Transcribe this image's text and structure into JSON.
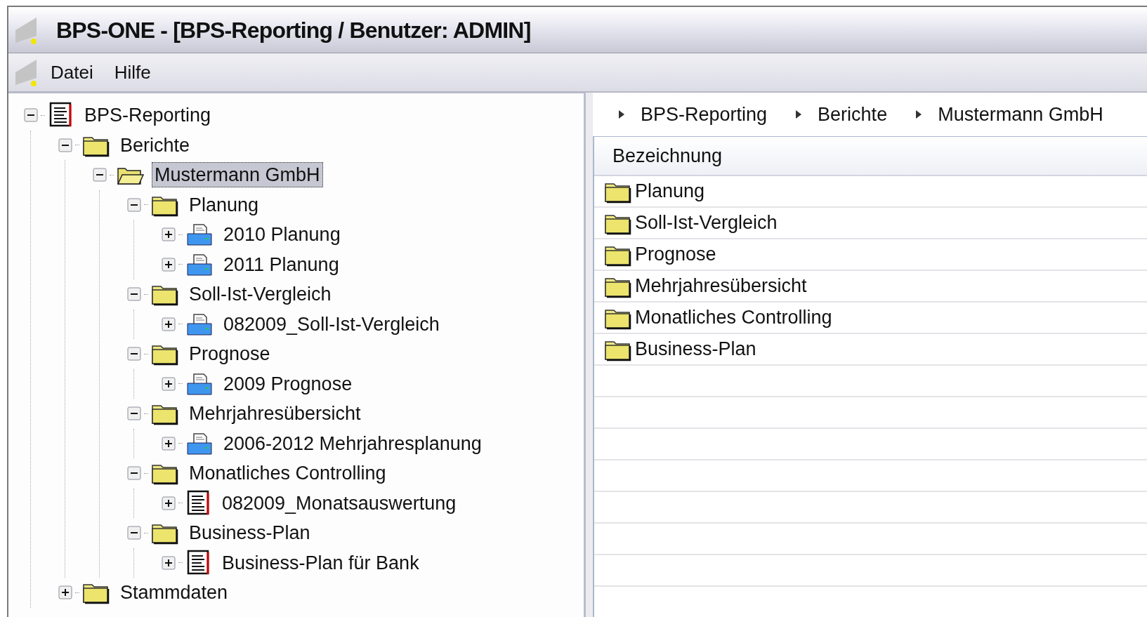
{
  "window": {
    "title": "BPS-ONE - [BPS-Reporting / Benutzer: ADMIN]"
  },
  "menu": [
    "Datei",
    "Hilfe"
  ],
  "tree": [
    {
      "label": "BPS-Reporting",
      "kind": "report",
      "expanded": true,
      "selected": false,
      "children": [
        {
          "label": "Berichte",
          "kind": "folder",
          "expanded": true,
          "selected": false,
          "children": [
            {
              "label": "Mustermann GmbH",
              "kind": "folder",
              "expanded": true,
              "selected": true,
              "children": [
                {
                  "label": "Planung",
                  "kind": "folder",
                  "expanded": true,
                  "selected": false,
                  "children": [
                    {
                      "label": "2010 Planung",
                      "kind": "print",
                      "expanded": false,
                      "selected": false
                    },
                    {
                      "label": "2011 Planung",
                      "kind": "print",
                      "expanded": false,
                      "selected": false
                    }
                  ]
                },
                {
                  "label": "Soll-Ist-Vergleich",
                  "kind": "folder",
                  "expanded": true,
                  "selected": false,
                  "children": [
                    {
                      "label": "082009_Soll-Ist-Vergleich",
                      "kind": "print",
                      "expanded": false,
                      "selected": false
                    }
                  ]
                },
                {
                  "label": "Prognose",
                  "kind": "folder",
                  "expanded": true,
                  "selected": false,
                  "children": [
                    {
                      "label": "2009 Prognose",
                      "kind": "print",
                      "expanded": false,
                      "selected": false
                    }
                  ]
                },
                {
                  "label": "Mehrjahresübersicht",
                  "kind": "folder",
                  "expanded": true,
                  "selected": false,
                  "children": [
                    {
                      "label": "2006-2012 Mehrjahresplanung",
                      "kind": "print",
                      "expanded": false,
                      "selected": false
                    }
                  ]
                },
                {
                  "label": "Monatliches Controlling",
                  "kind": "folder",
                  "expanded": true,
                  "selected": false,
                  "children": [
                    {
                      "label": "082009_Monatsauswertung",
                      "kind": "report",
                      "expanded": false,
                      "selected": false
                    }
                  ]
                },
                {
                  "label": "Business-Plan",
                  "kind": "folder",
                  "expanded": true,
                  "selected": false,
                  "children": [
                    {
                      "label": "Business-Plan für Bank",
                      "kind": "report",
                      "expanded": false,
                      "selected": false
                    }
                  ]
                }
              ]
            }
          ]
        },
        {
          "label": "Stammdaten",
          "kind": "folder",
          "expanded": false,
          "selected": false
        }
      ]
    }
  ],
  "breadcrumb": [
    "BPS-Reporting",
    "Berichte",
    "Mustermann GmbH"
  ],
  "table": {
    "columns": [
      "Bezeichnung"
    ],
    "rows": [
      {
        "label": "Planung",
        "kind": "folder"
      },
      {
        "label": "Soll-Ist-Vergleich",
        "kind": "folder"
      },
      {
        "label": "Prognose",
        "kind": "folder"
      },
      {
        "label": "Mehrjahresübersicht",
        "kind": "folder"
      },
      {
        "label": "Monatliches Controlling",
        "kind": "folder"
      },
      {
        "label": "Business-Plan",
        "kind": "folder"
      }
    ]
  }
}
